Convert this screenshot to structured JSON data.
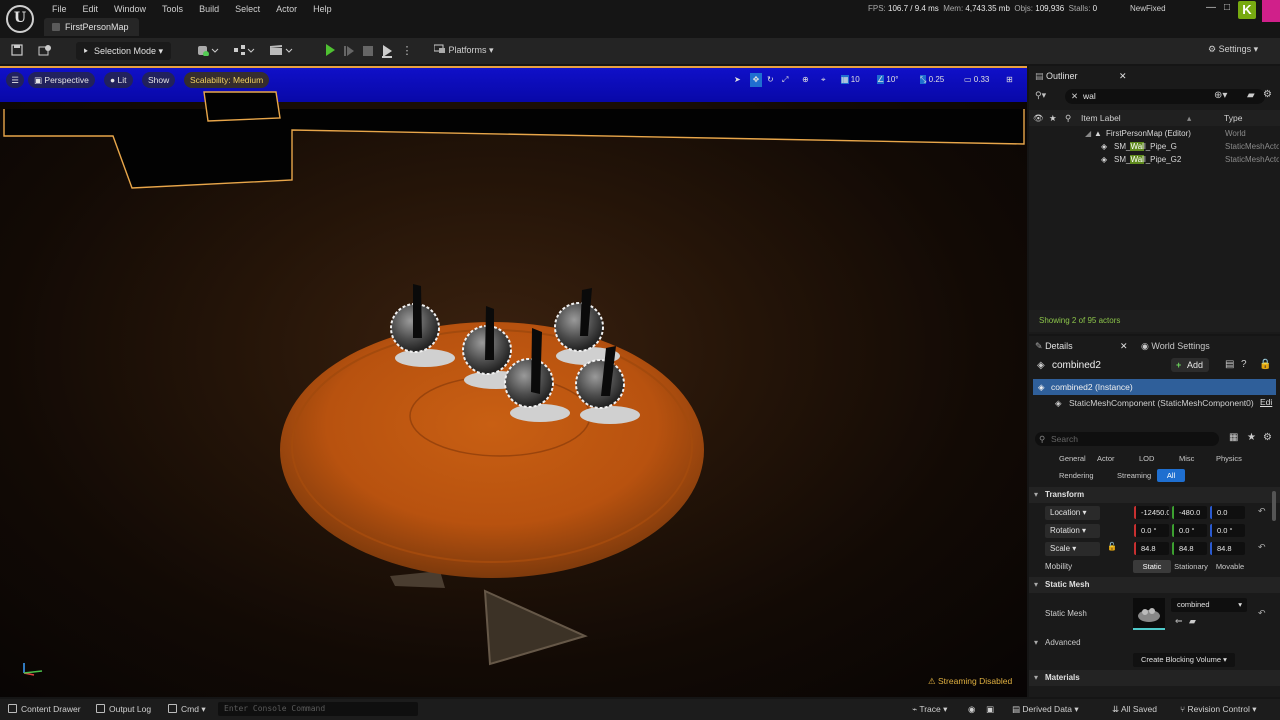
{
  "titlebar": {
    "menu": [
      "File",
      "Edit",
      "Window",
      "Tools",
      "Build",
      "Select",
      "Actor",
      "Help"
    ],
    "map_tab": "FirstPersonMap",
    "fps_label": "FPS:",
    "fps_value": "106.7",
    "ms_value": "/ 9.4 ms",
    "mem_label": "Mem:",
    "mem_value": "4,743.35 mb",
    "objs_label": "Objs:",
    "objs_value": "109,936",
    "stalls_label": "Stalls:",
    "stalls_value": "0",
    "project_name": "NewFixed",
    "minimize": "—",
    "maximize": "□"
  },
  "toolbar": {
    "selection_mode": "Selection Mode",
    "platforms": "Platforms",
    "settings": "Settings"
  },
  "viewport": {
    "perspective": "Perspective",
    "lit": "Lit",
    "show": "Show",
    "scalability": "Scalability: Medium",
    "grid_snap": "10",
    "rot_snap": "10°",
    "scale_snap": "0.25",
    "cam_speed": "0.33",
    "streaming": "Streaming Disabled"
  },
  "outliner": {
    "tab": "Outliner",
    "search": "wal",
    "col_label": "Item Label",
    "col_type": "Type",
    "rows": [
      {
        "label": "FirstPersonMap (Editor)",
        "type": "World"
      },
      {
        "pre": "SM_",
        "hl": "Wal",
        "post": "l_Pipe_G",
        "type": "StaticMeshActor"
      },
      {
        "pre": "SM_",
        "hl": "Wal",
        "post": "l_Pipe_G2",
        "type": "StaticMeshActor"
      }
    ],
    "count": "Showing 2 of 95 actors"
  },
  "details": {
    "tab": "Details",
    "world_tab": "World Settings",
    "actor_name": "combined2",
    "add_label": "Add",
    "instance": "combined2 (Instance)",
    "component": "StaticMeshComponent (StaticMeshComponent0)",
    "edit_link": "Edi",
    "search_placeholder": "Search",
    "categories_row1": [
      "General",
      "Actor",
      "LOD",
      "Misc",
      "Physics"
    ],
    "categories_row2": [
      "Rendering",
      "Streaming",
      "All"
    ],
    "transform_hdr": "Transform",
    "location_label": "Location",
    "rotation_label": "Rotation",
    "scale_label": "Scale",
    "location": [
      "-12450.0",
      "-480.0",
      "0.0"
    ],
    "rotation": [
      "0.0 °",
      "0.0 °",
      "0.0 °"
    ],
    "scale": [
      "84.8",
      "84.8",
      "84.8"
    ],
    "mobility_label": "Mobility",
    "mobility": [
      "Static",
      "Stationary",
      "Movable"
    ],
    "static_mesh_hdr": "Static Mesh",
    "static_mesh_label": "Static Mesh",
    "mesh_value": "combined",
    "advanced": "Advanced",
    "blocking_volume": "Create Blocking Volume",
    "materials_hdr": "Materials"
  },
  "statusbar": {
    "content_drawer": "Content Drawer",
    "output_log": "Output Log",
    "cmd": "Cmd",
    "console_placeholder": "Enter Console Command",
    "trace": "Trace",
    "derived_data": "Derived Data",
    "all_saved": "All Saved",
    "revision_control": "Revision Control"
  }
}
